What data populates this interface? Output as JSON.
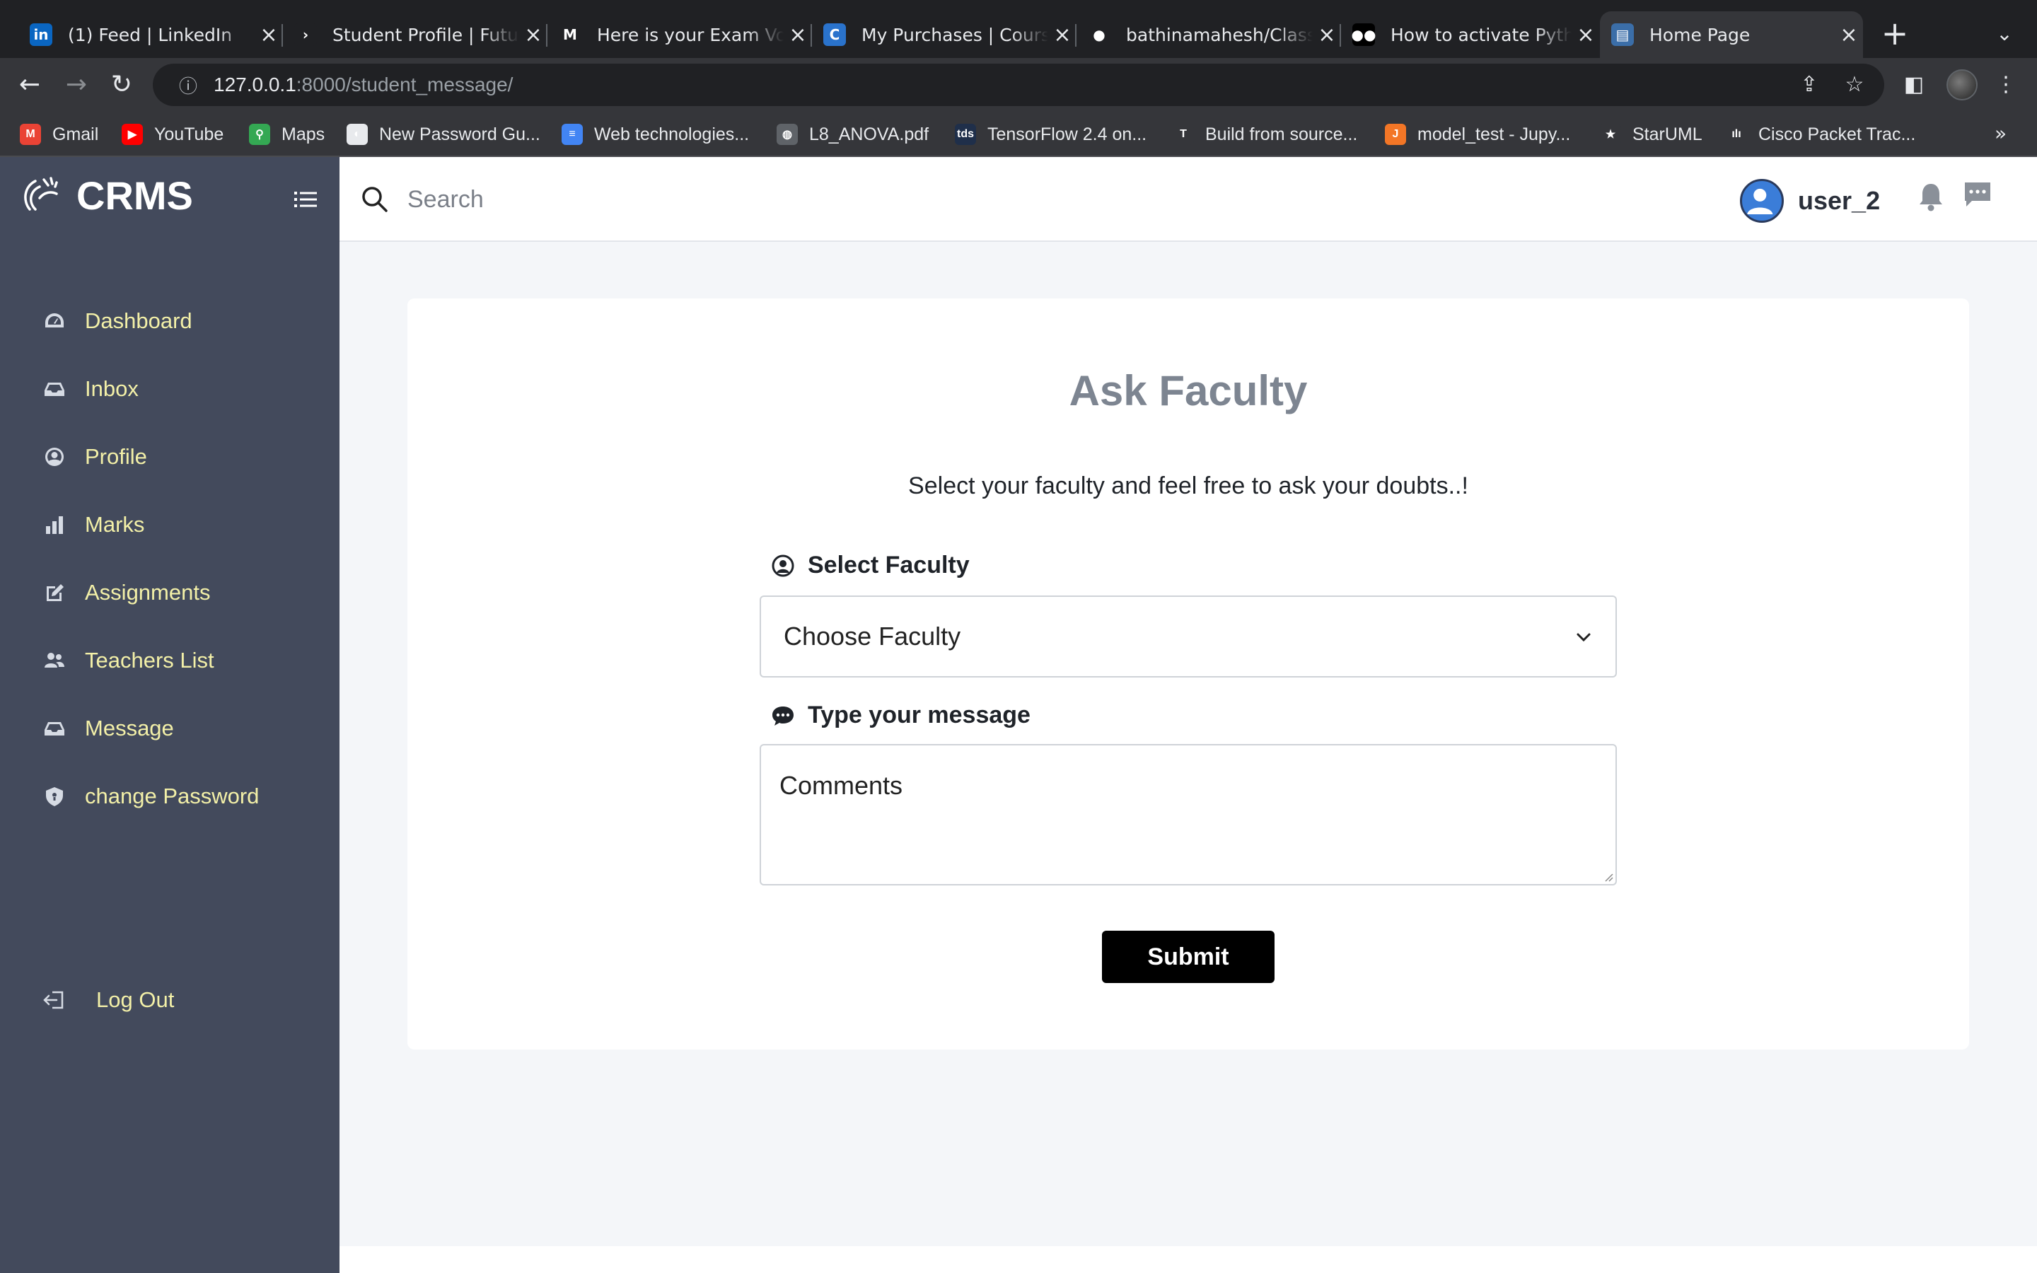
{
  "browser": {
    "tabs": [
      {
        "title": "(1) Feed | LinkedIn",
        "icon": "linkedin-icon",
        "color": "#0a66c2",
        "glyph": "in"
      },
      {
        "title": "Student Profile | Future",
        "icon": "future-icon",
        "color": "#202124",
        "glyph": "›"
      },
      {
        "title": "Here is your Exam Vou",
        "icon": "gmail-icon",
        "color": "#202124",
        "glyph": "M"
      },
      {
        "title": "My Purchases | Cours",
        "icon": "coursera-icon",
        "color": "#2a73cc",
        "glyph": "C"
      },
      {
        "title": "bathinamahesh/Class",
        "icon": "github-icon",
        "color": "#202124",
        "glyph": "●"
      },
      {
        "title": "How to activate Pytho",
        "icon": "medium-icon",
        "color": "#000000",
        "glyph": "●●"
      },
      {
        "title": "Home Page",
        "icon": "page-icon",
        "color": "#3b6ea8",
        "glyph": "▤"
      }
    ],
    "url_host": "127.0.0.1",
    "url_rest": ":8000/student_message/",
    "bookmarks": [
      {
        "label": "Gmail",
        "icon": "gmail-icon",
        "color": "#ea4335",
        "glyph": "M"
      },
      {
        "label": "YouTube",
        "icon": "youtube-icon",
        "color": "#ff0000",
        "glyph": "▶"
      },
      {
        "label": "Maps",
        "icon": "maps-icon",
        "color": "#34a853",
        "glyph": "⚲"
      },
      {
        "label": "New Password Gu...",
        "icon": "password-icon",
        "color": "#e8eaed",
        "glyph": "◐"
      },
      {
        "label": "Web technologies...",
        "icon": "docs-icon",
        "color": "#4285f4",
        "glyph": "≡"
      },
      {
        "label": "L8_ANOVA.pdf",
        "icon": "globe-icon",
        "color": "#5f6368",
        "glyph": "◍"
      },
      {
        "label": "TensorFlow 2.4 on...",
        "icon": "tds-icon",
        "color": "#1f2f4a",
        "glyph": "tds"
      },
      {
        "label": "Build from source...",
        "icon": "tensorflow-icon",
        "color": "#35363a",
        "glyph": "T"
      },
      {
        "label": "model_test - Jupy...",
        "icon": "jupyter-icon",
        "color": "#f37626",
        "glyph": "J"
      },
      {
        "label": "StarUML",
        "icon": "staruml-icon",
        "color": "#35363a",
        "glyph": "★"
      },
      {
        "label": "Cisco Packet Trac...",
        "icon": "cisco-icon",
        "color": "#35363a",
        "glyph": "ılı"
      }
    ],
    "bookmarks_more": "»"
  },
  "app": {
    "brand": "CRMS",
    "nav": [
      {
        "label": "Dashboard",
        "icon": "dashboard-icon"
      },
      {
        "label": "Inbox",
        "icon": "inbox-icon"
      },
      {
        "label": "Profile",
        "icon": "profile-icon"
      },
      {
        "label": "Marks",
        "icon": "bar-chart-icon"
      },
      {
        "label": "Assignments",
        "icon": "edit-icon"
      },
      {
        "label": "Teachers List",
        "icon": "users-icon"
      },
      {
        "label": "Message",
        "icon": "inbox-icon"
      },
      {
        "label": "change Password",
        "icon": "shield-icon"
      }
    ],
    "logout_label": "Log Out",
    "search_placeholder": "Search",
    "username": "user_2"
  },
  "form": {
    "title": "Ask Faculty",
    "subtitle": "Select your faculty and feel free to ask your doubts..!",
    "faculty_label": "Select Faculty",
    "faculty_selected": "Choose Faculty",
    "message_label": "Type your message",
    "message_placeholder": "Comments",
    "submit_label": "Submit"
  }
}
